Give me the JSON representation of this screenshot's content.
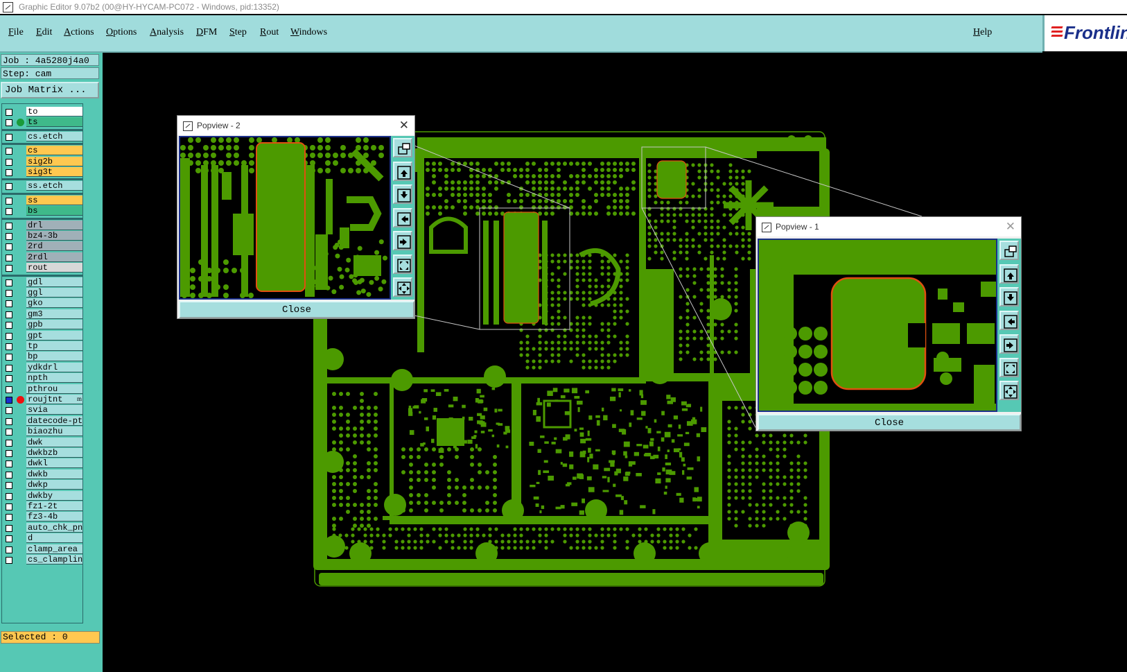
{
  "window": {
    "title": "Graphic Editor 9.07b2 (00@HY-HYCAM-PC072 - Windows, pid:13352)"
  },
  "menu": [
    "File",
    "Edit",
    "Actions",
    "Options",
    "Analysis",
    "DFM",
    "Step",
    "Rout",
    "Windows"
  ],
  "help": "Help",
  "logo": "Frontline",
  "job": "Job : 4a5280j4a0",
  "step": "Step: cam",
  "job_matrix": "Job Matrix ...",
  "layers": [
    {
      "name": "to",
      "color": "#ffffff",
      "dot": ""
    },
    {
      "name": "ts",
      "color": "#3fb98a",
      "dot": "#1a9a3a"
    },
    {
      "name": "cs.etch",
      "color": "#a6dede",
      "dot": ""
    },
    {
      "name": "cs",
      "color": "#ffc850",
      "dot": ""
    },
    {
      "name": "sig2b",
      "color": "#ffc850",
      "dot": ""
    },
    {
      "name": "sig3t",
      "color": "#ffc850",
      "dot": ""
    },
    {
      "name": "ss.etch",
      "color": "#a6dede",
      "dot": ""
    },
    {
      "name": "ss",
      "color": "#ffc850",
      "dot": ""
    },
    {
      "name": "bs",
      "color": "#3fb98a",
      "dot": ""
    },
    {
      "name": "drl",
      "color": "#a0b0b8",
      "dot": ""
    },
    {
      "name": "bz4-3b",
      "color": "#a0b0b8",
      "dot": ""
    },
    {
      "name": "2rd",
      "color": "#a0b0b8",
      "dot": ""
    },
    {
      "name": "2rdl",
      "color": "#a0b0b8",
      "dot": ""
    },
    {
      "name": "rout",
      "color": "#d8d8d8",
      "dot": ""
    },
    {
      "name": "gdl",
      "color": "#a6dede",
      "dot": ""
    },
    {
      "name": "ggl",
      "color": "#a6dede",
      "dot": ""
    },
    {
      "name": "gko",
      "color": "#a6dede",
      "dot": ""
    },
    {
      "name": "gm3",
      "color": "#a6dede",
      "dot": ""
    },
    {
      "name": "gpb",
      "color": "#a6dede",
      "dot": ""
    },
    {
      "name": "gpt",
      "color": "#a6dede",
      "dot": ""
    },
    {
      "name": "tp",
      "color": "#a6dede",
      "dot": ""
    },
    {
      "name": "bp",
      "color": "#a6dede",
      "dot": ""
    },
    {
      "name": "ydkdrl",
      "color": "#a6dede",
      "dot": ""
    },
    {
      "name": "npth",
      "color": "#a6dede",
      "dot": ""
    },
    {
      "name": "pthrou",
      "color": "#a6dede",
      "dot": ""
    },
    {
      "name": "roujtnt",
      "color": "#a6dede",
      "dot": "#ee1010",
      "checked": true,
      "mark": "m"
    },
    {
      "name": "svia",
      "color": "#a6dede",
      "dot": ""
    },
    {
      "name": "datecode-pt",
      "color": "#a6dede",
      "dot": ""
    },
    {
      "name": "biaozhu",
      "color": "#a6dede",
      "dot": ""
    },
    {
      "name": "dwk",
      "color": "#a6dede",
      "dot": ""
    },
    {
      "name": "dwkbzb",
      "color": "#a6dede",
      "dot": ""
    },
    {
      "name": "dwkl",
      "color": "#a6dede",
      "dot": ""
    },
    {
      "name": "dwkb",
      "color": "#a6dede",
      "dot": ""
    },
    {
      "name": "dwkp",
      "color": "#a6dede",
      "dot": ""
    },
    {
      "name": "dwkby",
      "color": "#a6dede",
      "dot": ""
    },
    {
      "name": "fz1-2t",
      "color": "#a6dede",
      "dot": ""
    },
    {
      "name": "fz3-4b",
      "color": "#a6dede",
      "dot": ""
    },
    {
      "name": "auto_chk_pn",
      "color": "#a6dede",
      "dot": ""
    },
    {
      "name": "d",
      "color": "#a6dede",
      "dot": ""
    },
    {
      "name": "clamp_area",
      "color": "#a6dede",
      "dot": ""
    },
    {
      "name": "cs_clampline",
      "color": "#a6dede",
      "dot": ""
    }
  ],
  "selected": "Selected : 0",
  "popview2": {
    "title": "Popview - 2",
    "close": "Close"
  },
  "popview1": {
    "title": "Popview - 1",
    "close": "Close"
  },
  "colors": {
    "copper": "#4c9a00",
    "panel": "#56c8b4",
    "menu": "#a0dcdc",
    "outline": "#e05010"
  }
}
